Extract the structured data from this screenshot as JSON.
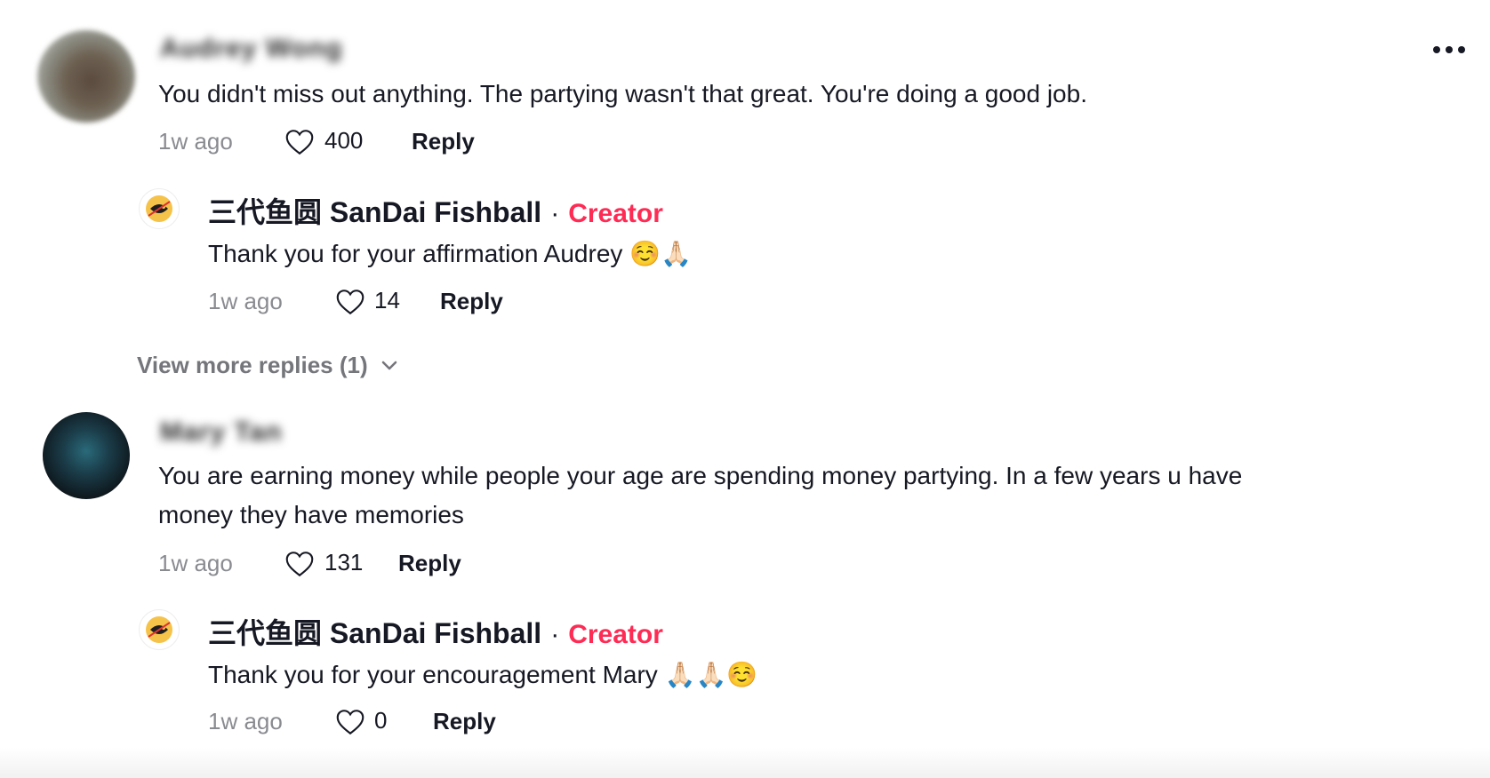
{
  "menu": {
    "icon": "more-horizontal-icon"
  },
  "comments": [
    {
      "author": "Audrey Wong",
      "text": "You didn't miss out anything. The partying wasn't that great. You're doing a good job.",
      "time": "1w ago",
      "likes": "400",
      "reply_label": "Reply"
    },
    {
      "author": "Mary Tan",
      "text_line1": "You are earning money while people your age are spending money partying. In a few years u have",
      "text_line2": "money they have memories",
      "time": "1w ago",
      "likes": "131",
      "reply_label": "Reply"
    }
  ],
  "replies": [
    {
      "author": "三代鱼圆 SanDai Fishball",
      "separator": "·",
      "badge": "Creator",
      "text": "Thank you for your affirmation Audrey ☺️🙏🏻",
      "time": "1w ago",
      "likes": "14",
      "reply_label": "Reply"
    },
    {
      "author": "三代鱼圆 SanDai Fishball",
      "separator": "·",
      "badge": "Creator",
      "text": "Thank you for your encouragement Mary 🙏🏻🙏🏻☺️",
      "time": "1w ago",
      "likes": "0",
      "reply_label": "Reply"
    }
  ],
  "view_more": {
    "label": "View more replies (1)",
    "icon": "chevron-down-icon"
  },
  "colors": {
    "creator": "#fe2c55",
    "text": "#161823",
    "muted": "#8a8b91"
  }
}
